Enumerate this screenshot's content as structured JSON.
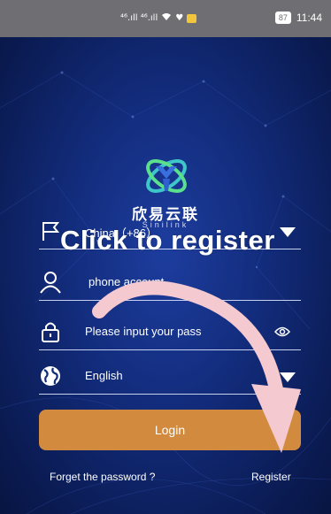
{
  "status_bar": {
    "signal_icons": "⁴⁶.ıll ⁴⁶.ıll",
    "battery": "87",
    "time": "11:44"
  },
  "brand": {
    "name_cn": "欣易云联",
    "name_en": "Sinilink"
  },
  "form": {
    "country": "China（+86）",
    "phone_placeholder": "phone account",
    "password_placeholder": "Please input your pass",
    "language": "English"
  },
  "buttons": {
    "login": "Login",
    "forget": "Forget the password ?",
    "register": "Register"
  },
  "annotation": {
    "text": "Click to register",
    "arrow_color": "#f4c9cf"
  },
  "colors": {
    "login_button": "#d18a3e",
    "background": "#132d7e"
  }
}
